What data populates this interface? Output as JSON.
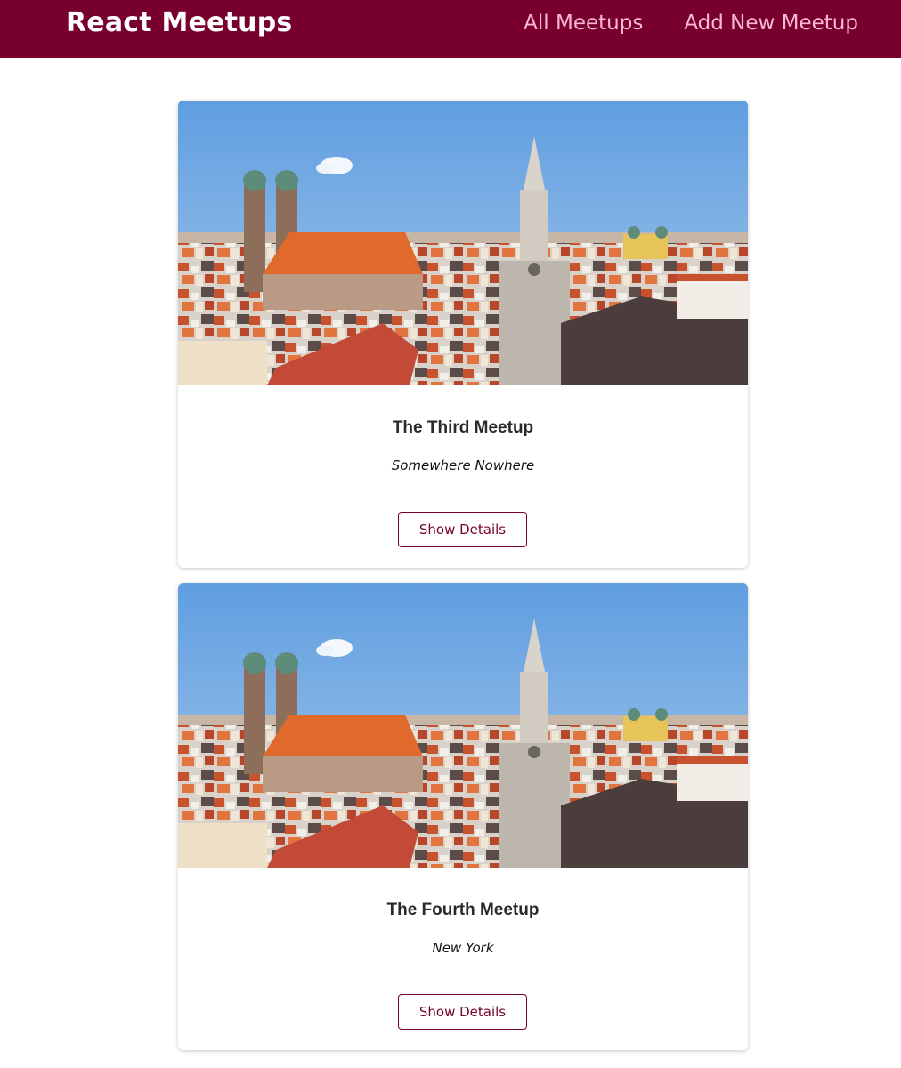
{
  "header": {
    "logo": "React Meetups",
    "nav": [
      {
        "label": "All Meetups"
      },
      {
        "label": "Add New Meetup"
      }
    ]
  },
  "meetups": [
    {
      "image": "city-skyline-photo",
      "title": "The Third Meetup",
      "address": "Somewhere Nowhere",
      "button": "Show Details"
    },
    {
      "image": "city-skyline-photo",
      "title": "The Fourth Meetup",
      "address": "New York",
      "button": "Show Details"
    }
  ],
  "colors": {
    "header_bg": "#77002e",
    "nav_link": "#fcb8d2",
    "accent": "#77002e"
  }
}
